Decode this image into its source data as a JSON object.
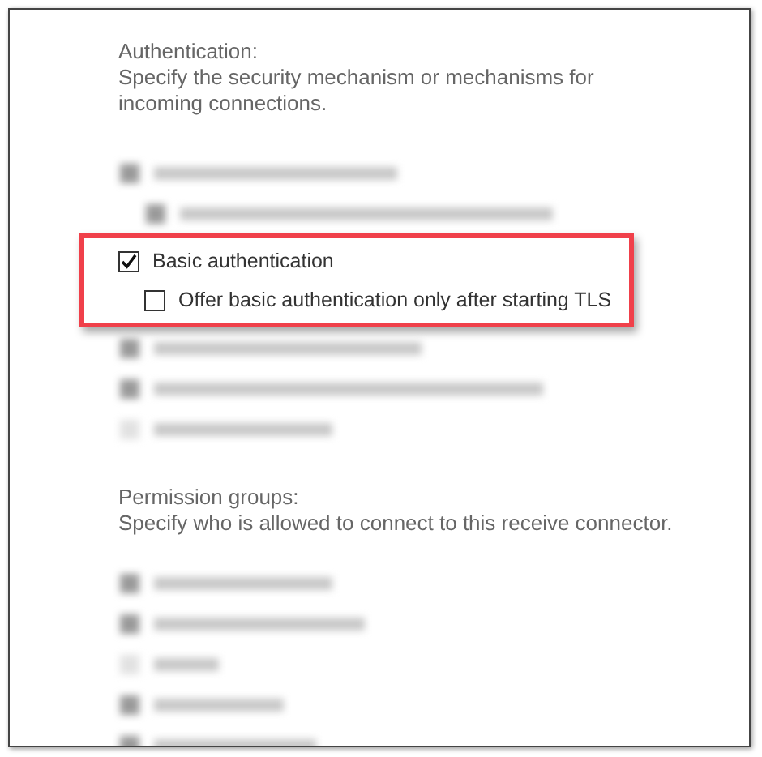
{
  "authentication": {
    "title": "Authentication:",
    "description": "Specify the security mechanism or mechanisms for incoming connections.",
    "options": [
      {
        "kind": "blurred",
        "checked": true,
        "children": [
          {
            "kind": "blurred",
            "checked": true
          }
        ]
      },
      {
        "kind": "checkbox",
        "label": "Basic authentication",
        "checked": true,
        "highlighted": true,
        "children": [
          {
            "kind": "checkbox",
            "label": "Offer basic authentication only after starting TLS",
            "checked": false
          }
        ]
      },
      {
        "kind": "blurred",
        "checked": true
      },
      {
        "kind": "blurred",
        "checked": true
      },
      {
        "kind": "blurred",
        "checked": false
      }
    ]
  },
  "permission_groups": {
    "title": "Permission groups:",
    "description": "Specify who is allowed to connect to this receive connector.",
    "options": [
      {
        "kind": "blurred",
        "checked": true
      },
      {
        "kind": "blurred",
        "checked": true
      },
      {
        "kind": "blurred",
        "checked": false
      },
      {
        "kind": "blurred",
        "checked": true
      },
      {
        "kind": "blurred",
        "checked": true
      }
    ]
  }
}
